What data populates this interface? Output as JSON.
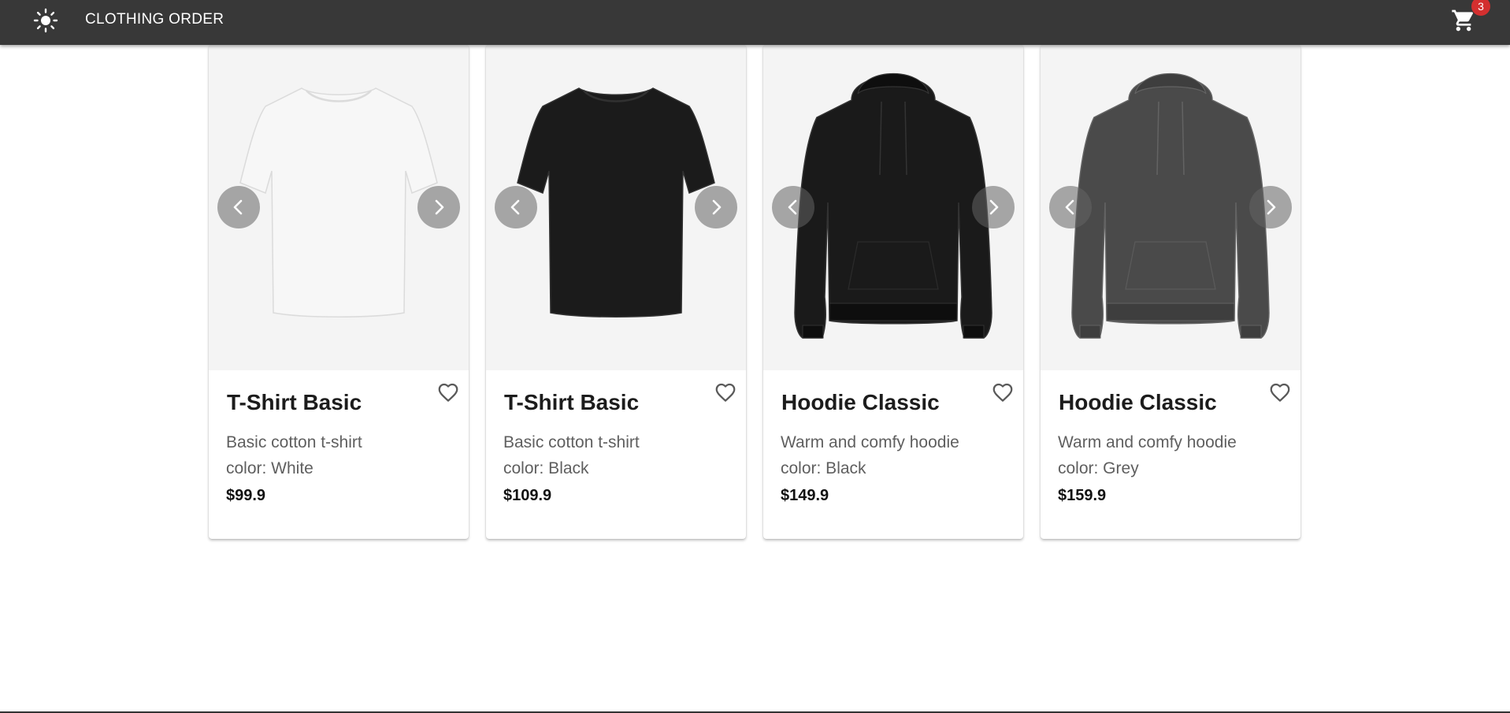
{
  "app": {
    "title": "CLOTHING ORDER",
    "theme_icon": "sun-icon",
    "cart_icon": "shopping-cart-icon",
    "cart_count": "3",
    "colors": {
      "appbar": "#383838",
      "badge": "#d32f2f"
    }
  },
  "products": [
    {
      "title": "T-Shirt Basic",
      "description": "Basic cotton t-shirt",
      "color_line": "color: White",
      "price": "$99.9",
      "garment": "tshirt",
      "garment_color": "#f7f7f7"
    },
    {
      "title": "T-Shirt Basic",
      "description": "Basic cotton t-shirt",
      "color_line": "color: Black",
      "price": "$109.9",
      "garment": "tshirt",
      "garment_color": "#1b1b1b"
    },
    {
      "title": "Hoodie Classic",
      "description": "Warm and comfy hoodie",
      "color_line": "color: Black",
      "price": "$149.9",
      "garment": "hoodie",
      "garment_color": "#1a1a1a"
    },
    {
      "title": "Hoodie Classic",
      "description": "Warm and comfy hoodie",
      "color_line": "color: Grey",
      "price": "$159.9",
      "garment": "hoodie",
      "garment_color": "#4a4a4a"
    }
  ],
  "icons": {
    "prev": "chevron-left-icon",
    "next": "chevron-right-icon",
    "favorite": "heart-outline-icon"
  }
}
